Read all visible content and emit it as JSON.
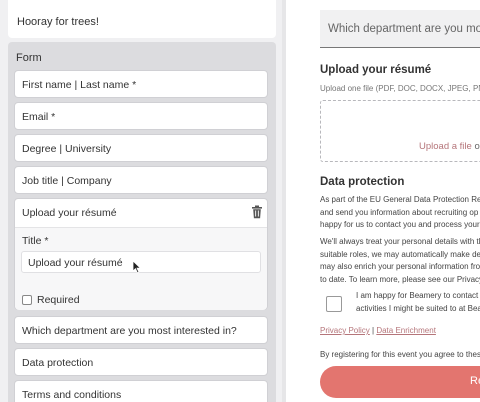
{
  "left": {
    "top_card_text": "Hooray for trees!",
    "form_title": "Form",
    "items_before": [
      {
        "label": "First name | Last name *"
      },
      {
        "label": "Email *"
      },
      {
        "label": "Degree | University"
      },
      {
        "label": "Job title | Company"
      }
    ],
    "expanded": {
      "title": "Upload your résumé",
      "field_label": "Title *",
      "field_value": "Upload your résumé",
      "required_label": "Required",
      "required_checked": false
    },
    "items_after": [
      {
        "label": "Which department are you most interested in?"
      },
      {
        "label": "Data protection"
      },
      {
        "label": "Terms and conditions"
      }
    ]
  },
  "right": {
    "select_placeholder": "Which department are you most",
    "upload_heading": "Upload your résumé",
    "upload_hint": "Upload one file (PDF, DOC, DOCX, JPEG, PNG,",
    "upload_link": "Upload a file",
    "upload_or": " or",
    "data_protection_heading": "Data protection",
    "para1": [
      "As part of the EU General Data Protection Reg",
      "and send you information about recruiting op",
      "happy for us to contact you and process your"
    ],
    "para2": [
      "We'll always treat your personal details with th",
      "suitable roles, we may automatically make de",
      "may also enrich your personal information fro",
      "to date. To learn more, please see our Privacy"
    ],
    "consent_lines": [
      "I am happy for Beamery to contact",
      "activities I might be suited to at Bea"
    ],
    "privacy_link": "Privacy Policy",
    "link_separator": " | ",
    "enrichment_link": "Data Enrichment",
    "terms_text": "By registering for this event you agree to thes",
    "register_label": "Re"
  },
  "colors": {
    "accent": "#e3756f",
    "link": "#b5757a",
    "panel_bg": "#dcdcdf"
  }
}
